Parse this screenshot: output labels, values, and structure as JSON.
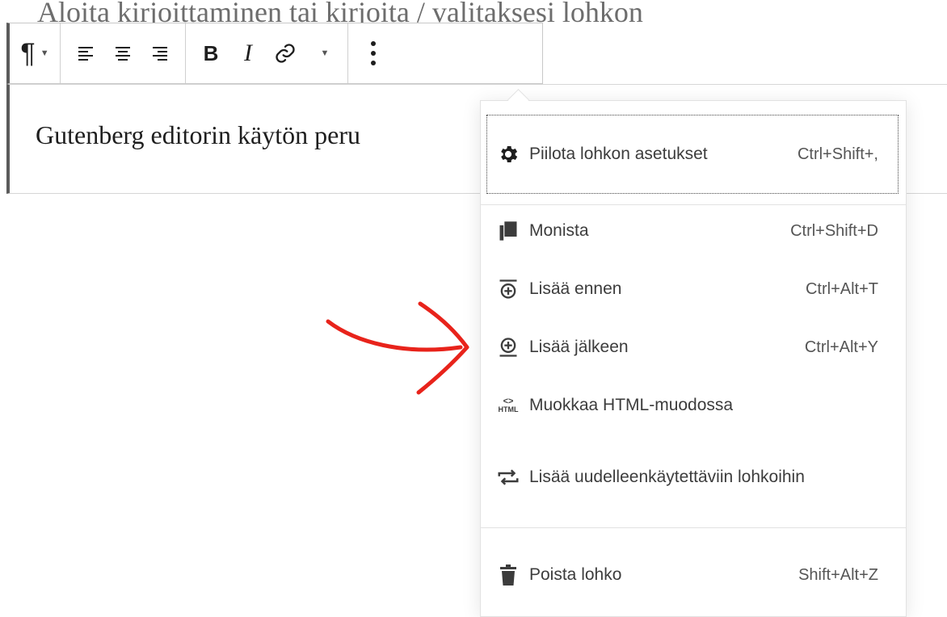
{
  "editor": {
    "placeholder": "Aloita kirjoittaminen tai kirjoita / valitaksesi lohkon",
    "block_text": "Gutenberg editorin käytön peru"
  },
  "toolbar": {
    "paragraph_icon": "pilcrow-icon",
    "align_left_icon": "align-left-icon",
    "align_center_icon": "align-center-icon",
    "align_right_icon": "align-right-icon",
    "bold_label": "B",
    "italic_label": "I",
    "link_icon": "link-icon",
    "more_icon": "vertical-ellipsis-icon"
  },
  "menu": {
    "items": [
      {
        "label": "Piilota lohkon asetukset",
        "shortcut": "Ctrl+Shift+,",
        "icon": "gear-icon"
      },
      {
        "label": "Monista",
        "shortcut": "Ctrl+Shift+D",
        "icon": "duplicate-icon"
      },
      {
        "label": "Lisää ennen",
        "shortcut": "Ctrl+Alt+T",
        "icon": "insert-before-icon"
      },
      {
        "label": "Lisää jälkeen",
        "shortcut": "Ctrl+Alt+Y",
        "icon": "insert-after-icon"
      },
      {
        "label": "Muokkaa HTML-muodossa",
        "shortcut": "",
        "icon": "html-icon"
      },
      {
        "label": "Lisää uudelleenkäytettäviin lohkoihin",
        "shortcut": "",
        "icon": "reusable-icon"
      },
      {
        "label": "Poista lohko",
        "shortcut": "Shift+Alt+Z",
        "icon": "trash-icon"
      }
    ],
    "html_icon_text": "HTML"
  },
  "annotation": {
    "color": "#e8231b"
  }
}
